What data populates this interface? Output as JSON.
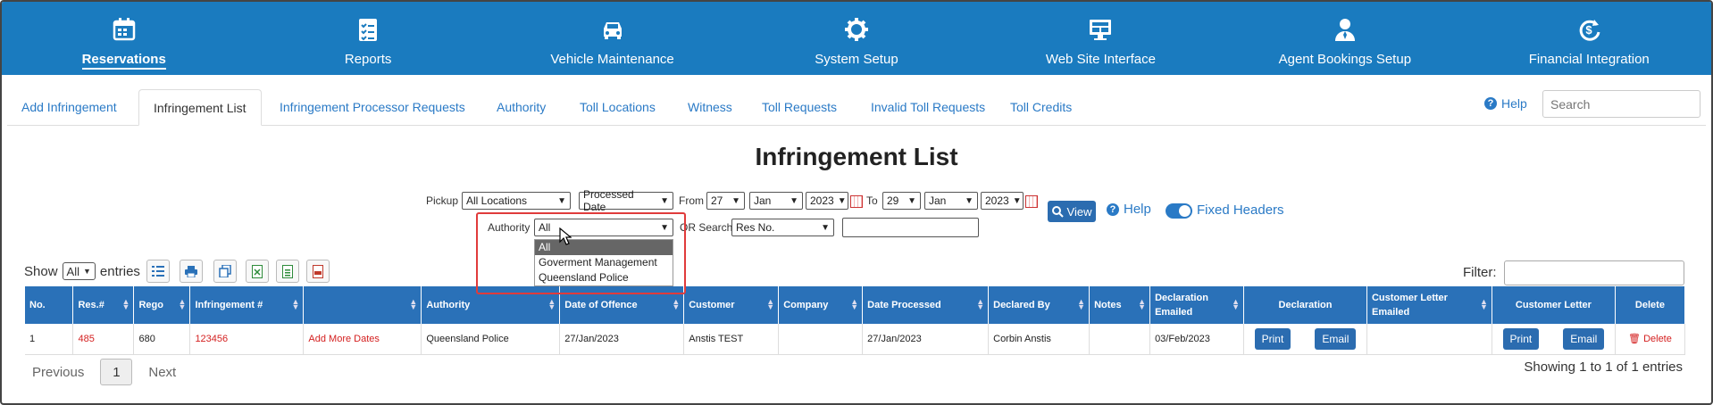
{
  "nav": {
    "items": [
      {
        "label": "Reservations",
        "icon": "calendar-icon"
      },
      {
        "label": "Reports",
        "icon": "checklist-icon"
      },
      {
        "label": "Vehicle Maintenance",
        "icon": "car-icon"
      },
      {
        "label": "System Setup",
        "icon": "gear-icon"
      },
      {
        "label": "Web Site Interface",
        "icon": "monitor-icon"
      },
      {
        "label": "Agent Bookings Setup",
        "icon": "agent-icon"
      },
      {
        "label": "Financial Integration",
        "icon": "dollar-sync-icon"
      }
    ],
    "active": "Reservations"
  },
  "tabs": [
    "Add Infringement",
    "Infringement List",
    "Infringement Processor Requests",
    "Authority",
    "Toll Locations",
    "Witness",
    "Toll Requests",
    "Invalid Toll Requests",
    "Toll Credits"
  ],
  "header": {
    "help": "Help",
    "search_placeholder": "Search"
  },
  "page_title": "Infringement List",
  "filters": {
    "pickup_label": "Pickup",
    "pickup_value": "All Locations",
    "date_type": "Processed Date",
    "from_label": "From",
    "from_day": "27",
    "from_month": "Jan",
    "from_year": "2023",
    "to_label": "To",
    "to_day": "29",
    "to_month": "Jan",
    "to_year": "2023",
    "authority_label": "Authority",
    "authority_value": "All",
    "or_search_label": "OR Search",
    "search_by": "Res No.",
    "view_label": "View",
    "help_label": "Help",
    "fixed_headers_label": "Fixed Headers"
  },
  "authority_dropdown": [
    "All",
    "Goverment Management",
    "Queensland Police"
  ],
  "table_controls": {
    "show_label": "Show",
    "show_value": "All",
    "entries_label": "entries",
    "filter_label": "Filter:"
  },
  "columns": [
    "No.",
    "Res.#",
    "Rego",
    "Infringement #",
    "",
    "Authority",
    "Date of Offence",
    "Customer",
    "Company",
    "Date Processed",
    "Declared By",
    "Notes",
    "Declaration Emailed",
    "Declaration",
    "Customer Letter Emailed",
    "Customer Letter",
    "Delete"
  ],
  "rows": [
    {
      "no": "1",
      "res": "485",
      "rego": "680",
      "infringement": "123456",
      "action": "Add More Dates",
      "authority": "Queensland Police",
      "offence_date": "27/Jan/2023",
      "customer": "Anstis TEST",
      "company": "",
      "processed": "27/Jan/2023",
      "declared_by": "Corbin Anstis",
      "notes": "",
      "decl_emailed": "03/Feb/2023",
      "print": "Print",
      "email": "Email",
      "cl_emailed": "",
      "cl_print": "Print",
      "cl_email": "Email",
      "delete": "Delete"
    }
  ],
  "pagination": {
    "prev": "Previous",
    "page": "1",
    "next": "Next",
    "info": "Showing 1 to 1 of 1 entries"
  },
  "colors": {
    "nav_bg": "#1a7bbf",
    "header_bg": "#2a71b8",
    "link": "#2a7ac6",
    "highlight": "#e03b3b"
  }
}
